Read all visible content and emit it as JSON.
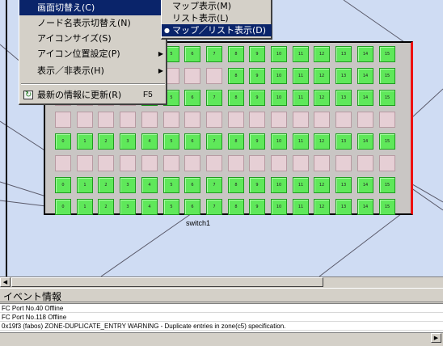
{
  "colors": {
    "map_background": "#cfdcf3",
    "port_active": "#5fe85a",
    "port_inactive": "#e6cfd5",
    "menu_highlight": "#0a246a"
  },
  "context_menu": {
    "items": [
      {
        "label": "画面切替え(C)",
        "highlighted": true,
        "submenu": true
      },
      {
        "label": "ノード名表示切替え(N)"
      },
      {
        "label": "アイコンサイズ(S)"
      },
      {
        "label": "アイコン位置設定(P)",
        "submenu": true
      },
      {
        "label": "表示／非表示(H)",
        "submenu": true
      },
      {
        "label": "最新の情報に更新(R)",
        "shortcut": "F5",
        "icon": "refresh-icon"
      }
    ]
  },
  "submenu": {
    "items": [
      {
        "label": "マップ表示(M)"
      },
      {
        "label": "リスト表示(L)"
      },
      {
        "label": "マップ／リスト表示(D)",
        "selected": true,
        "highlighted": true
      }
    ]
  },
  "switch": {
    "label": "switch1",
    "port_numbers": [
      "0",
      "1",
      "2",
      "3",
      "4",
      "5",
      "6",
      "7",
      "8",
      "9",
      "10",
      "11",
      "12",
      "13",
      "14",
      "15"
    ],
    "rows": [
      {
        "visible_ports": [
          4,
          5,
          6,
          7,
          8,
          9,
          10,
          11,
          12,
          13,
          14,
          15
        ],
        "active": true
      },
      {
        "visible_ports": [
          8,
          9,
          10,
          11,
          12,
          13,
          14,
          15
        ],
        "active": true
      },
      {
        "visible_ports": [
          4,
          5,
          6,
          7,
          8,
          9,
          10,
          11,
          12,
          13,
          14,
          15
        ],
        "active": true
      },
      {
        "visible_ports": [],
        "active": false
      },
      {
        "visible_ports": [
          0,
          1,
          2,
          3,
          4,
          5,
          6,
          7,
          8,
          9,
          10,
          11,
          12,
          13,
          14,
          15
        ],
        "active": true
      },
      {
        "visible_ports": [],
        "active": false
      },
      {
        "visible_ports": [
          0,
          1,
          2,
          3,
          4,
          5,
          6,
          7,
          8,
          9,
          10,
          11,
          12,
          13,
          14,
          15
        ],
        "active": true
      },
      {
        "visible_ports": [
          0,
          1,
          2,
          3,
          4,
          5,
          6,
          7,
          8,
          9,
          10,
          11,
          12,
          13,
          14,
          15
        ],
        "active": true
      }
    ]
  },
  "events": {
    "title": "イベント情報",
    "rows": [
      "FC Port No.40 Offline",
      "FC Port No.118 Offline",
      "0x19f3 (fabos) ZONE-DUPLICATE_ENTRY WARNING - Duplicate entries in zone(c5) specification."
    ]
  },
  "scrollbar": {
    "left_arrow": "◀",
    "right_arrow": "▶"
  }
}
